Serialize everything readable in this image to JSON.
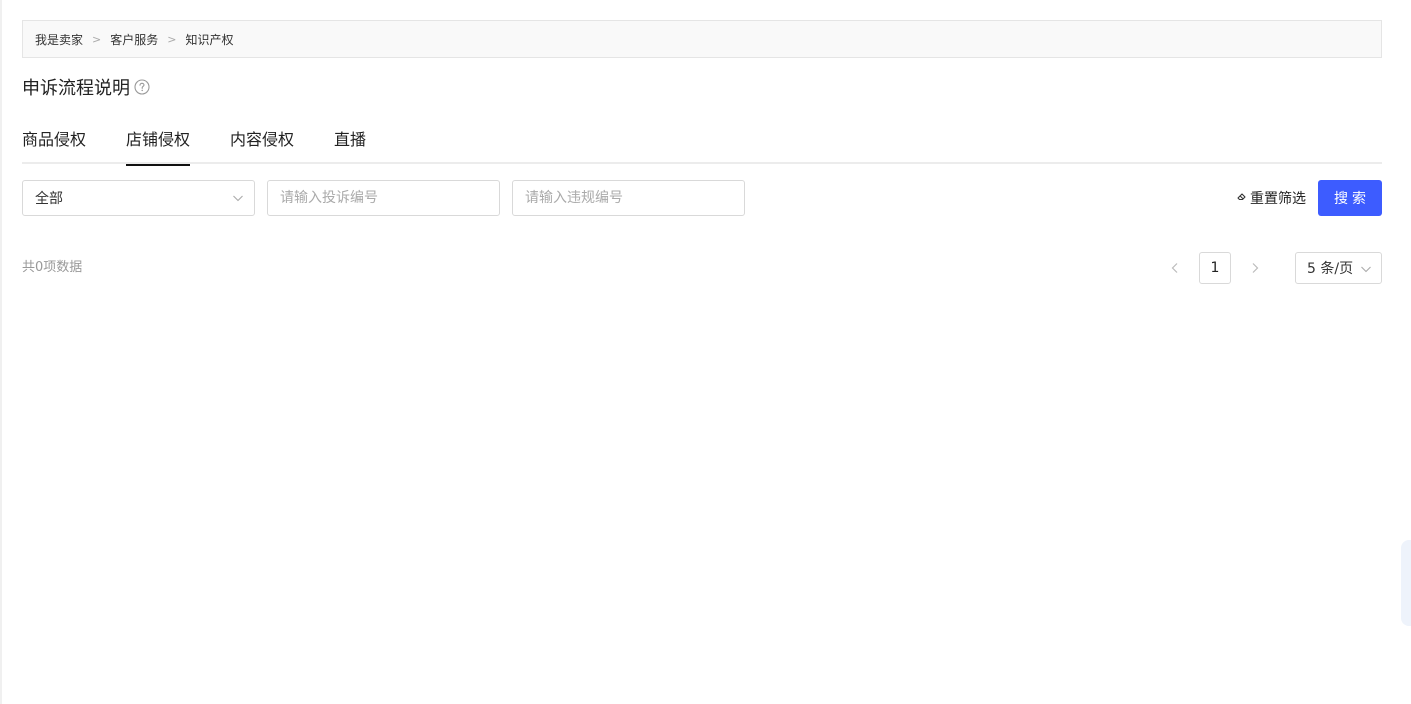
{
  "breadcrumb": {
    "items": [
      "我是卖家",
      "客户服务",
      "知识产权"
    ],
    "separator": ">"
  },
  "page_title": "申诉流程说明",
  "tabs": [
    {
      "label": "商品侵权",
      "active": false
    },
    {
      "label": "店铺侵权",
      "active": true
    },
    {
      "label": "内容侵权",
      "active": false
    },
    {
      "label": "直播",
      "active": false
    }
  ],
  "filters": {
    "select_value": "全部",
    "complaint_placeholder": "请输入投诉编号",
    "violation_placeholder": "请输入违规编号",
    "reset_label": "重置筛选",
    "search_label": "搜索"
  },
  "results": {
    "total_text": "共0项数据"
  },
  "pagination": {
    "current_page": "1",
    "page_size": "5 条/页"
  },
  "colors": {
    "accent": "#3d5cff",
    "border": "#d9d9d9",
    "breadcrumb_bg": "#f9f9f9"
  },
  "icons": {
    "help": "question-circle-icon",
    "select_chevron": "chevron-down-icon",
    "reset": "eraser-icon",
    "prev": "chevron-left-icon",
    "next": "chevron-right-icon"
  }
}
